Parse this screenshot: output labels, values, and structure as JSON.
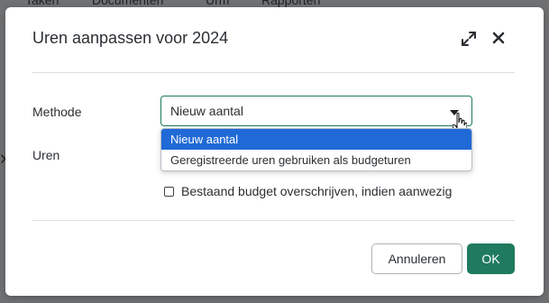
{
  "background_nav": {
    "items": [
      "Taken",
      "Documenten",
      "Urm",
      "Rapporten"
    ]
  },
  "modal": {
    "title": "Uren aanpassen voor 2024",
    "expand_icon": "expand-icon",
    "close_icon": "close-icon"
  },
  "form": {
    "methode_label": "Methode",
    "uren_label": "Uren",
    "methode_select": {
      "value": "Nieuw aantal",
      "options": [
        "Nieuw aantal",
        "Geregistreerde uren gebruiken als budgeturen"
      ],
      "selected_index": 0
    },
    "overwrite_checkbox": {
      "label": "Bestaand budget overschrijven, indien aanwezig",
      "checked": false
    }
  },
  "footer": {
    "cancel_label": "Annuleren",
    "ok_label": "OK"
  },
  "colors": {
    "primary": "#1f7a5e",
    "selected_option": "#1f6ad6",
    "overlay": "#6f7173"
  }
}
